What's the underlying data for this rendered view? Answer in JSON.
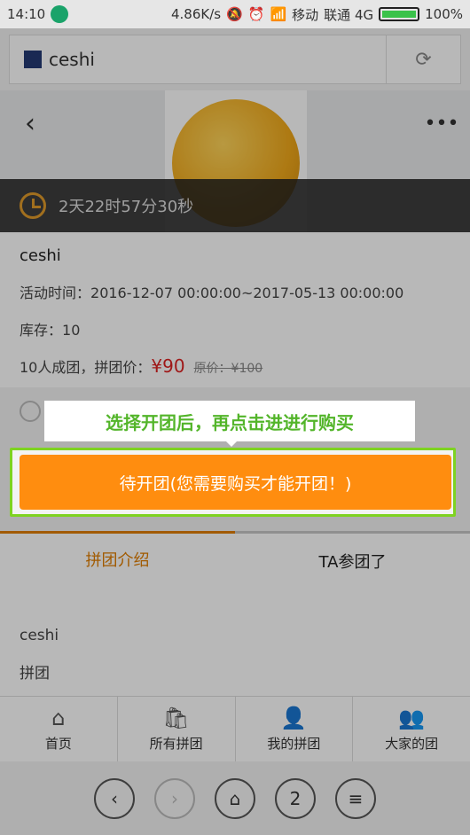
{
  "status": {
    "time": "14:10",
    "speed": "4.86K/s",
    "carrier1": "移动",
    "carrier2": "联通 4G",
    "battery": "100%"
  },
  "browser": {
    "tab_title": "ceshi"
  },
  "timer": {
    "text": "2天22时57分30秒"
  },
  "product": {
    "name": "ceshi",
    "activity_label": "活动时间：",
    "activity_range": "2016-12-07 00:00:00~2017-05-13 00:00:00",
    "stock_label": "库存：",
    "stock_value": "10",
    "group_label": "10人成团，拼团价：",
    "group_price": "¥90",
    "original_price": "原价：¥100"
  },
  "tip": {
    "text": "选择开团后，再点击进进行购买"
  },
  "main_button": {
    "label": "待开团(您需要购买才能开团！)"
  },
  "tabs": [
    {
      "label": "拼团介绍"
    },
    {
      "label": "TA参团了"
    }
  ],
  "content": {
    "line1": "ceshi",
    "line2": "拼团"
  },
  "bottom_nav": [
    {
      "label": "首页",
      "icon": "home-icon"
    },
    {
      "label": "所有拼团",
      "icon": "bag-icon"
    },
    {
      "label": "我的拼团",
      "icon": "person-icon"
    },
    {
      "label": "大家的团",
      "icon": "people-icon"
    }
  ],
  "browser_controls": {
    "tabs_count": "2"
  },
  "colors": {
    "accent": "#ff8d0f",
    "tip_green": "#53b52a",
    "frame_green": "#7ed321",
    "price_red": "#d22222"
  }
}
